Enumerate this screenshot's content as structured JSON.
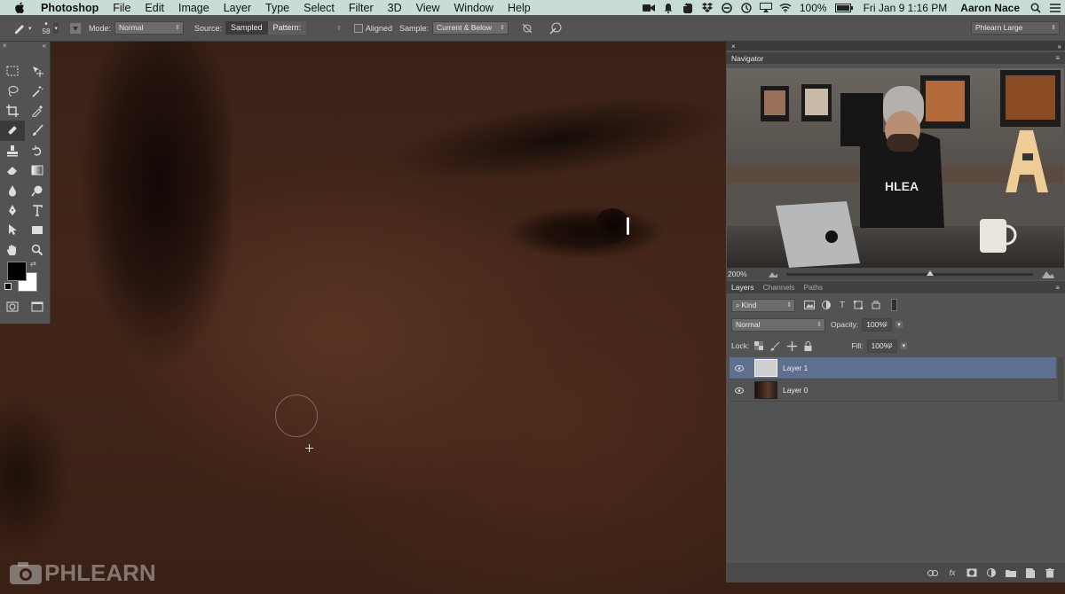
{
  "menubar": {
    "app_name": "Photoshop",
    "items": [
      "File",
      "Edit",
      "Image",
      "Layer",
      "Type",
      "Select",
      "Filter",
      "3D",
      "View",
      "Window",
      "Help"
    ],
    "battery": "100%",
    "datetime": "Fri Jan 9  1:16 PM",
    "user": "Aaron Nace"
  },
  "options": {
    "brush_size": "58",
    "mode_label": "Mode:",
    "mode_value": "Normal",
    "source_label": "Source:",
    "source_sampled": "Sampled",
    "source_pattern": "Pattern:",
    "aligned_label": "Aligned",
    "sample_label": "Sample:",
    "sample_value": "Current & Below",
    "workspace": "Phlearn Large"
  },
  "navigator": {
    "title": "Navigator",
    "zoom": "200%"
  },
  "layers_panel": {
    "tabs": [
      "Layers",
      "Channels",
      "Paths"
    ],
    "filter_kind": "Kind",
    "blend_mode": "Normal",
    "opacity_label": "Opacity:",
    "opacity_value": "100%",
    "lock_label": "Lock:",
    "fill_label": "Fill:",
    "fill_value": "100%",
    "layers": [
      {
        "name": "Layer 1",
        "selected": true
      },
      {
        "name": "Layer 0",
        "selected": false
      }
    ]
  },
  "watermark": "PHLEARN",
  "colors": {
    "menubar_bg": "#c9ddd8",
    "panel_bg": "#535353",
    "selected_layer": "#5e6f90",
    "foreground": "#000000",
    "background": "#ffffff"
  }
}
